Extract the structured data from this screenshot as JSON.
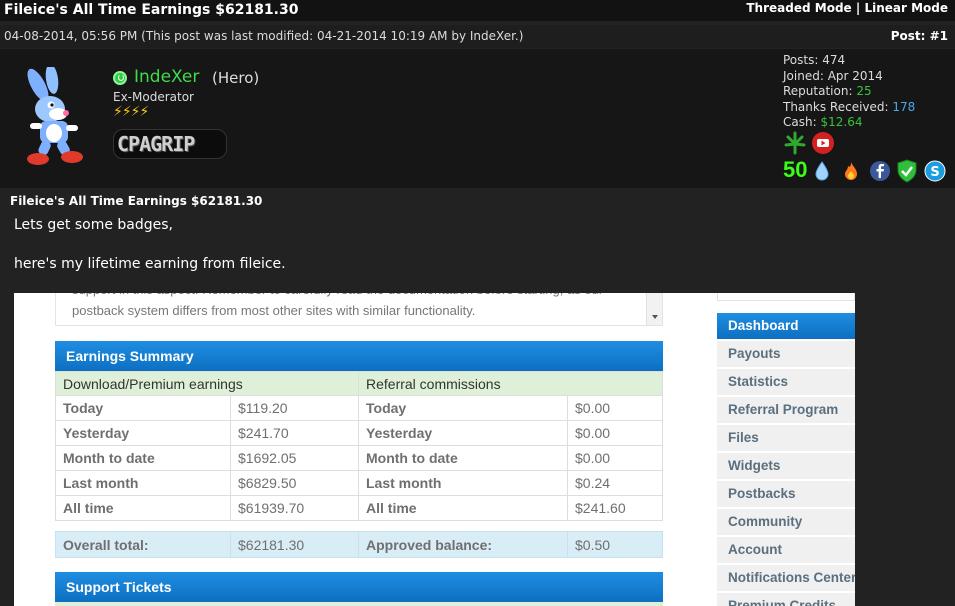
{
  "thread": {
    "title": "Fileice's All Time Earnings $62181.30",
    "modes": [
      "Threaded Mode",
      "Linear Mode"
    ],
    "mode_separator": "|"
  },
  "post": {
    "date": "04-08-2014, 05:56 PM (This post was last modified: 04-21-2014 10:19 AM by IndeXer.)",
    "number": "Post: #1",
    "subject": "Fileice's All Time Earnings $62181.30",
    "lines": [
      "Lets get some badges,",
      "here's my lifetime earning from fileice."
    ]
  },
  "user": {
    "name": "IndeXer",
    "rank": "(Hero)",
    "title": "Ex-Moderator",
    "bolts": "⚡⚡⚡⚡",
    "sponsor_logo": "CPAGRIP",
    "stats": {
      "posts_label": "Posts:",
      "posts": "474",
      "joined_label": "Joined:",
      "joined": "Apr 2014",
      "reputation_label": "Reputation:",
      "reputation": "25",
      "thanks_label": "Thanks Received:",
      "thanks": "178",
      "cash_label": "Cash:",
      "cash": "$12.64"
    },
    "badge_number": "50",
    "badges": [
      "leaf-icon",
      "youtube-icon",
      "water-drop-icon",
      "flame-icon",
      "facebook-icon",
      "shield-icon",
      "skype-icon"
    ]
  },
  "embed": {
    "notice": "support in this aspect. Remember to carefully read the documentation before starting, as our postback system differs from most other sites with similar functionality.",
    "earnings_title": "Earnings Summary",
    "headers": [
      "Download/Premium earnings",
      "Referral commissions"
    ],
    "rows": [
      {
        "label": "Today",
        "value": "$119.20",
        "ref_label": "Today",
        "ref_value": "$0.00"
      },
      {
        "label": "Yesterday",
        "value": "$241.70",
        "ref_label": "Yesterday",
        "ref_value": "$0.00"
      },
      {
        "label": "Month to date",
        "value": "$1692.05",
        "ref_label": "Month to date",
        "ref_value": "$0.00"
      },
      {
        "label": "Last month",
        "value": "$6829.50",
        "ref_label": "Last month",
        "ref_value": "$0.24"
      },
      {
        "label": "All time",
        "value": "$61939.70",
        "ref_label": "All time",
        "ref_value": "$241.60"
      }
    ],
    "totals": {
      "overall_label": "Overall total:",
      "overall": "$62181.30",
      "approved_label": "Approved balance:",
      "approved": "$0.50"
    },
    "tickets_title": "Support Tickets",
    "nav": [
      "Dashboard",
      "Payouts",
      "Statistics",
      "Referral Program",
      "Files",
      "Widgets",
      "Postbacks",
      "Community",
      "Account",
      "Notifications Center",
      "Premium Credits"
    ],
    "nav_active": "Dashboard"
  },
  "colors": {
    "page_bg": "#232323",
    "username": "#3ddc4a",
    "accent_blue": "#0d6fc1",
    "summary_green": "#dff0d8",
    "total_blue": "#d9edf7"
  }
}
